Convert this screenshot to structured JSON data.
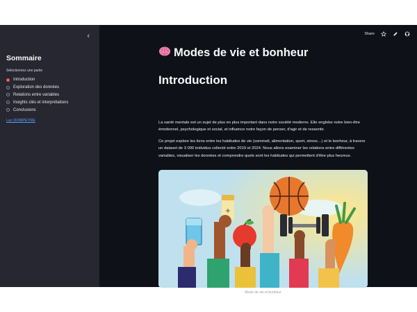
{
  "sidebar": {
    "collapse_icon": "chevron-left-icon",
    "title": "Sommaire",
    "radio_label": "Sélectionnez une partie",
    "items": [
      {
        "label": "Introduction",
        "selected": true
      },
      {
        "label": "Exploration des données",
        "selected": false
      },
      {
        "label": "Relations entre variables",
        "selected": false
      },
      {
        "label": "Insights clés et interprétations",
        "selected": false
      },
      {
        "label": "Conclusions",
        "selected": false
      }
    ],
    "author_link": "Luc DOMPEYRE"
  },
  "toolbar": {
    "share_label": "Share",
    "icons": [
      "star-icon",
      "edit-icon",
      "github-icon"
    ]
  },
  "main": {
    "title_icon": "brain-emoji",
    "title": "Modes de vie et bonheur",
    "heading": "Introduction",
    "paragraph1": "La santé mentale est un sujet de plus en plus important dans notre société moderne. Elle englobe notre bien-être émotionnel, psychologique et social, et influence notre façon de penser, d'agir et de ressentir.",
    "paragraph2": "Ce projet explore les liens entre les habitudes de vie (sommeil, alimentation, sport, stress…) et le bonheur, à travers un dataset de 3 000 individus collecté entre 2019 et 2024. Nous allons examiner les relations entre différentes variables, visualiser les données et comprendre quels sont les habitudes qui permettent d'être plus heureux.",
    "image_caption": "Mode de vie et bonheur"
  },
  "colors": {
    "sidebar_bg": "#262730",
    "main_bg": "#0e1117",
    "accent": "#ff4b4b",
    "link": "#5aa0ff"
  }
}
